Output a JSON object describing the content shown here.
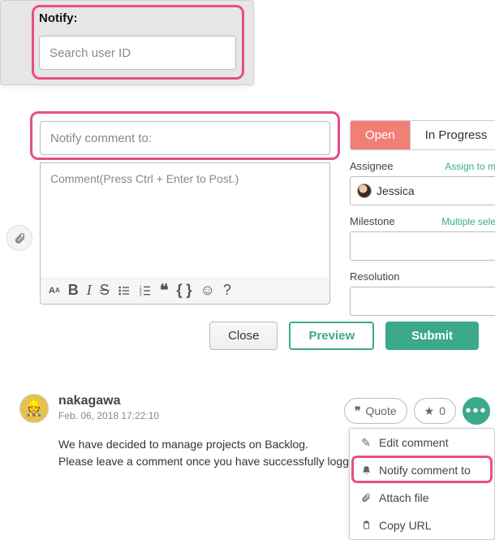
{
  "panel1": {
    "label": "Notify:",
    "placeholder": "Search user ID"
  },
  "composer": {
    "notify_placeholder": "Notify comment to:",
    "comment_placeholder": "Comment(Press Ctrl + Enter to Post.)"
  },
  "sidebar": {
    "status": {
      "open": "Open",
      "in_progress": "In Progress"
    },
    "assignee": {
      "label": "Assignee",
      "link": "Assign to m",
      "value": "Jessica"
    },
    "milestone": {
      "label": "Milestone",
      "link": "Multiple sele",
      "value": ""
    },
    "resolution": {
      "label": "Resolution",
      "value": ""
    }
  },
  "buttons": {
    "close": "Close",
    "preview": "Preview",
    "submit": "Submit"
  },
  "comment": {
    "author": "nakagawa",
    "timestamp": "Feb. 06, 2018 17:22:10",
    "line1": "We have decided to manage projects on Backlog.",
    "line2": "Please leave a comment once you have successfully logged",
    "quote_label": "Quote",
    "star_count": "0"
  },
  "menu": {
    "edit": "Edit comment",
    "notify": "Notify comment to",
    "attach": "Attach file",
    "copy": "Copy URL"
  }
}
